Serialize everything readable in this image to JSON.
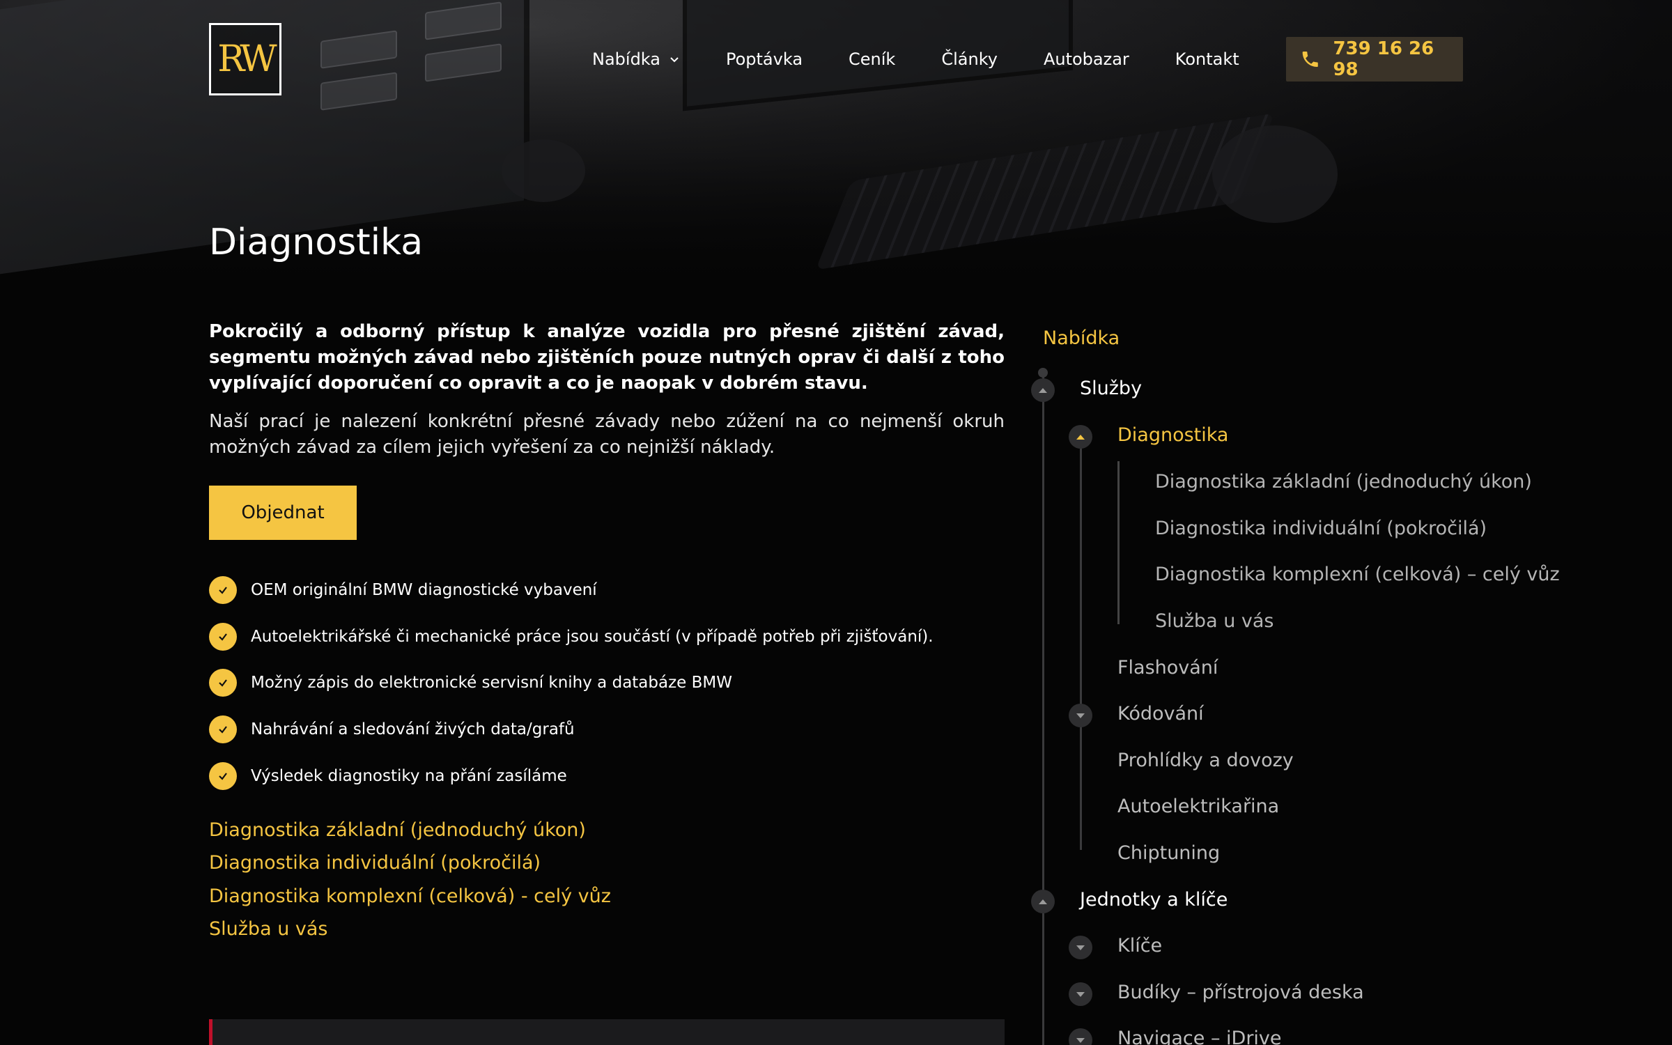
{
  "header": {
    "logo_text": "RW",
    "nav": [
      {
        "label": "Nabídka",
        "has_dropdown": true
      },
      {
        "label": "Poptávka"
      },
      {
        "label": "Ceník"
      },
      {
        "label": "Články"
      },
      {
        "label": "Autobazar"
      },
      {
        "label": "Kontakt"
      }
    ],
    "phone": "739 16 26 98"
  },
  "page": {
    "title": "Diagnostika",
    "lead": "Pokročilý a odborný přístup k analýze vozidla pro přesné zjištění závad, segmentu možných závad nebo zjištěních pouze nutných oprav či další z toho vyplívající doporučení co opravit a co je naopak v dobrém stavu.",
    "description": "Naší prací je nalezení konkrétní přesné závady nebo zúžení na co nejmenší okruh možných závad za cílem jejich vyřešení za co nejnižší náklady.",
    "order_button": "Objednat",
    "features": [
      "OEM originální BMW diagnostické vybavení",
      "Autoelektrikářské či mechanické práce jsou součástí (v případě potřeb při zjišťování).",
      "Možný zápis do elektronické servisní knihy a databáze BMW",
      "Nahrávání a sledování živých data/grafů",
      "Výsledek diagnostiky na přání zasíláme"
    ],
    "links": [
      "Diagnostika základní (jednoduchý úkon)",
      "Diagnostika individuální (pokročilá)",
      "Diagnostika komplexní (celková) - celý vůz",
      "Služba u vás"
    ]
  },
  "sidebar": {
    "heading": "Nabídka",
    "sluzby": "Služby",
    "diagnostika": "Diagnostika",
    "diagnostika_children": [
      "Diagnostika základní (jednoduchý úkon)",
      "Diagnostika individuální (pokročilá)",
      "Diagnostika komplexní (celková) – celý vůz",
      "Služba u vás"
    ],
    "sluzby_items": [
      "Flashování",
      "Kódování",
      "Prohlídky a dovozy",
      "Autoelektrikařina",
      "Chiptuning"
    ],
    "jednotky": "Jednotky a klíče",
    "jednotky_items": [
      "Klíče",
      "Budíky – přístrojová deska",
      "Navigace – iDrive"
    ]
  },
  "colors": {
    "accent": "#f5c542",
    "background": "#050505",
    "bottom_box_accent": "#c0102a"
  }
}
